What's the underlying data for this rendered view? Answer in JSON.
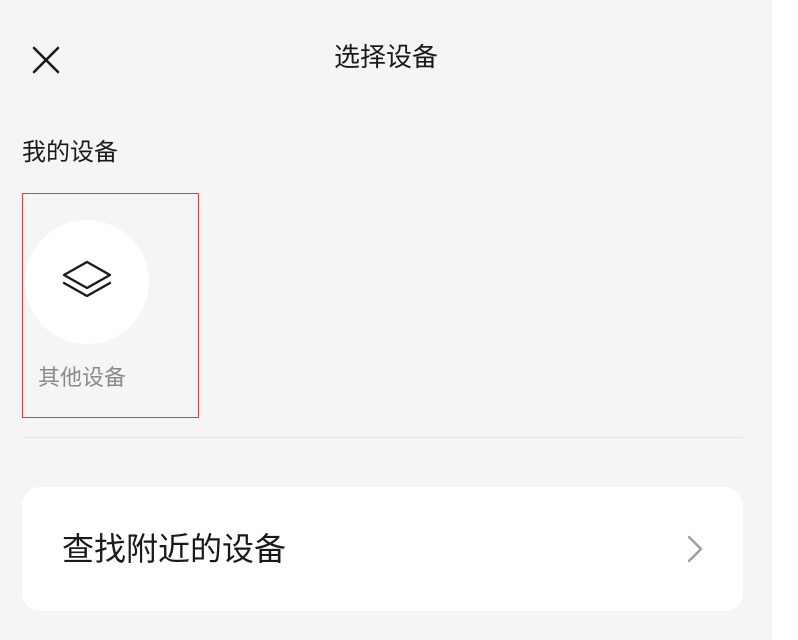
{
  "header": {
    "close_icon": "close-icon",
    "title": "选择设备"
  },
  "my_devices": {
    "section_label": "我的设备",
    "items": [
      {
        "label": "其他设备",
        "icon": "layers-icon"
      }
    ]
  },
  "nearby": {
    "label": "查找附近的设备",
    "chevron_icon": "chevron-right-icon"
  },
  "colors": {
    "background": "#f5f5f5",
    "card": "#ffffff",
    "highlight_border": "#e53935",
    "secondary_text": "#8a8a8a"
  }
}
